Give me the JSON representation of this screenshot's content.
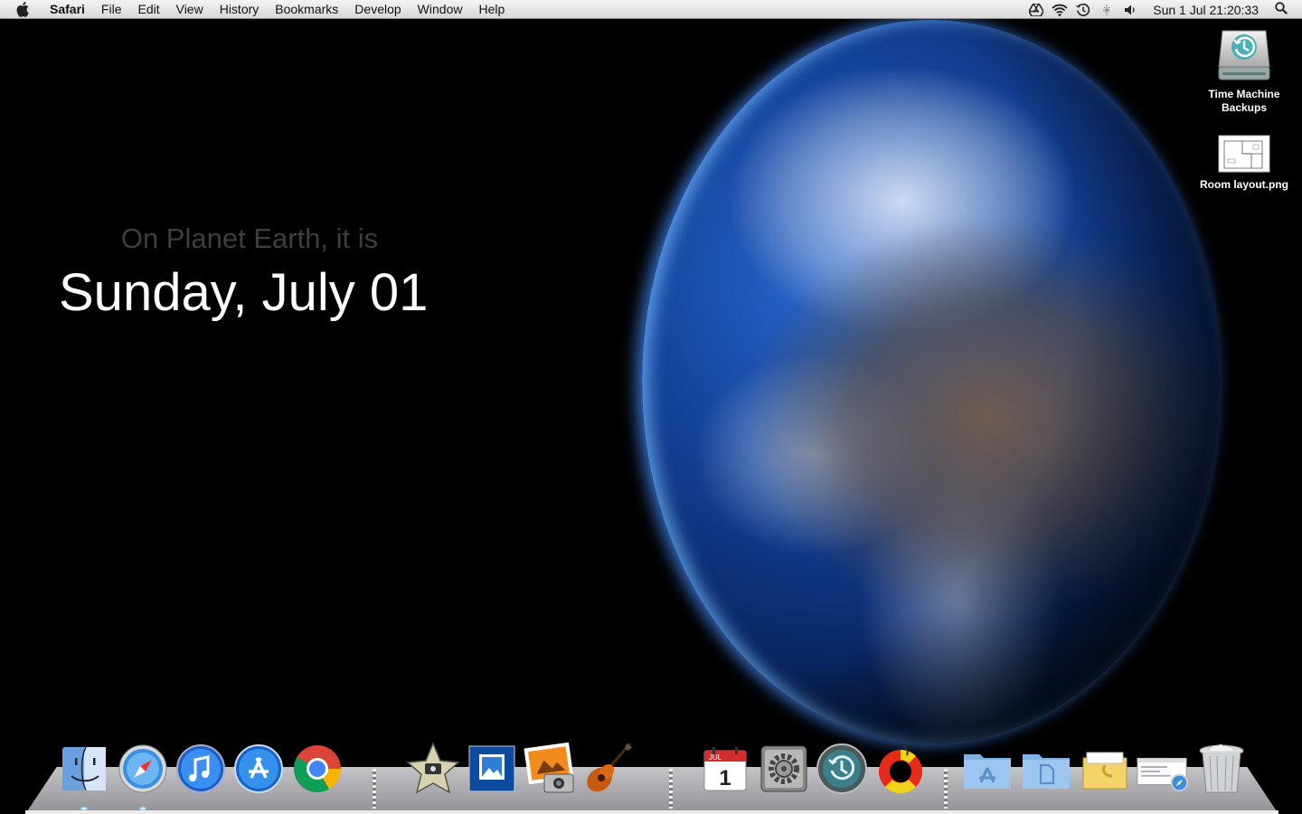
{
  "menubar": {
    "apple_icon": "apple-icon",
    "items": [
      {
        "label": "Safari",
        "app": true
      },
      {
        "label": "File"
      },
      {
        "label": "Edit"
      },
      {
        "label": "View"
      },
      {
        "label": "History"
      },
      {
        "label": "Bookmarks"
      },
      {
        "label": "Develop"
      },
      {
        "label": "Window"
      },
      {
        "label": "Help"
      }
    ],
    "status_icons": [
      "google-drive-icon",
      "wifi-icon",
      "time-machine-icon",
      "bluetooth-icon",
      "volume-icon"
    ],
    "clock": "Sun 1 Jul  21:20:33",
    "spotlight_icon": "spotlight-icon"
  },
  "wallpaper": {
    "tagline": "On Planet Earth, it is",
    "date": "Sunday, July 01"
  },
  "desktop": {
    "icons": [
      {
        "label": "Time Machine Backups",
        "icon": "time-machine-disk-icon"
      },
      {
        "label": "Room layout.png",
        "icon": "png-file-icon"
      }
    ]
  },
  "dock": {
    "apps": [
      {
        "name": "Finder",
        "icon": "finder-icon",
        "running": true
      },
      {
        "name": "Safari",
        "icon": "safari-icon",
        "running": true
      },
      {
        "name": "iTunes",
        "icon": "itunes-icon",
        "running": false
      },
      {
        "name": "App Store",
        "icon": "app-store-icon",
        "running": false
      },
      {
        "name": "Google Chrome",
        "icon": "chrome-icon",
        "running": false
      },
      {
        "name": "iMovie",
        "icon": "imovie-icon",
        "running": false
      },
      {
        "name": "Preview",
        "icon": "preview-icon",
        "running": false
      },
      {
        "name": "iPhoto",
        "icon": "iphoto-icon",
        "running": false
      },
      {
        "name": "GarageBand",
        "icon": "garageband-icon",
        "running": false
      },
      {
        "name": "Calendar",
        "icon": "calendar-icon",
        "running": false,
        "badge_month": "JUL",
        "badge_day": "1"
      },
      {
        "name": "System Preferences",
        "icon": "system-preferences-icon",
        "running": false
      },
      {
        "name": "Time Machine",
        "icon": "time-machine-icon",
        "running": false
      },
      {
        "name": "Help Viewer",
        "icon": "lifebuoy-icon",
        "running": false
      }
    ],
    "stacks": [
      {
        "name": "Applications",
        "icon": "applications-folder-icon"
      },
      {
        "name": "Documents",
        "icon": "documents-folder-icon"
      },
      {
        "name": "Downloads",
        "icon": "downloads-stack-icon"
      },
      {
        "name": "Web Page",
        "icon": "webpage-stack-icon"
      },
      {
        "name": "Trash",
        "icon": "trash-icon"
      }
    ]
  },
  "colors": {
    "menubar_top": "#f4f4f4",
    "menubar_bottom": "#d8d8d8",
    "background": "#000000",
    "tagline": "#3e3e3e",
    "date": "#ffffff"
  }
}
